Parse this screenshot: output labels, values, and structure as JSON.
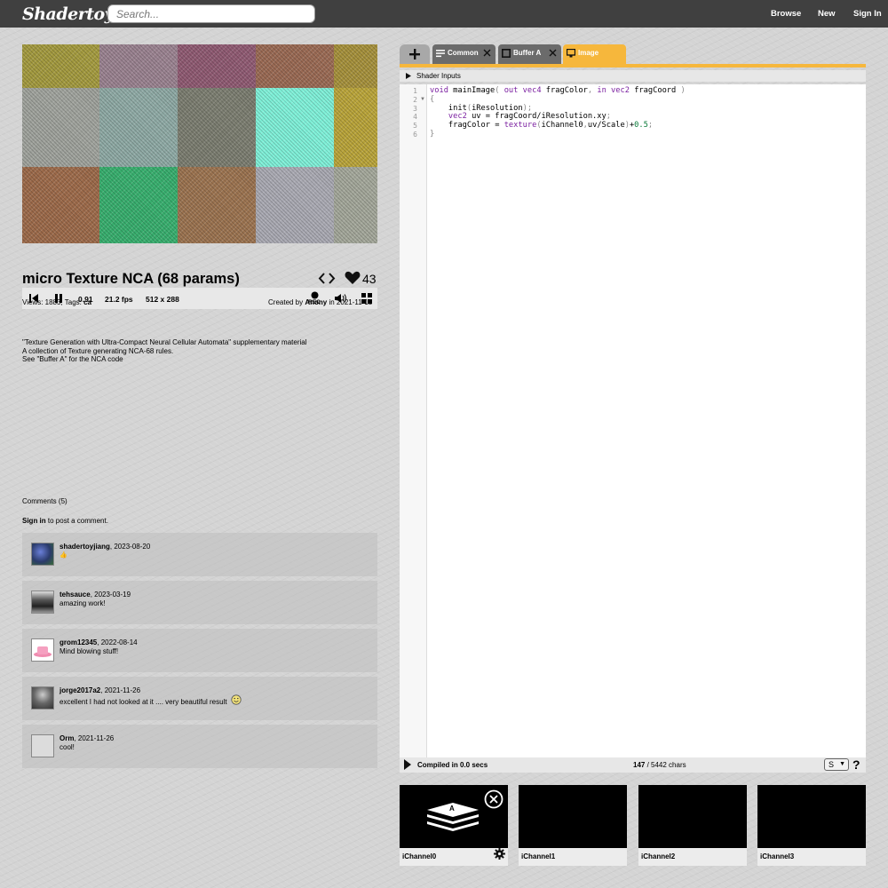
{
  "header": {
    "logo": "Shadertoy",
    "search_placeholder": "Search...",
    "nav": [
      "Browse",
      "New",
      "Sign In"
    ]
  },
  "player": {
    "time": "0.91",
    "fps": "21.2 fps",
    "resolution": "512 x 288",
    "rec_label": "REC",
    "tiles": [
      [
        "#a39a3f",
        "#9a8290",
        "#8f5a72",
        "#9a6a54",
        "#a6913c"
      ],
      [
        "#9fa29c",
        "#8ea9a4",
        "#7b7d70",
        "#7ff0d8",
        "#b9a43a"
      ],
      [
        "#9c6a4a",
        "#38ae6e",
        "#9b7350",
        "#a9a9b2",
        "#a3a79a"
      ]
    ]
  },
  "shader": {
    "title": "micro Texture NCA (68 params)",
    "likes": "43",
    "views_text": "Views: 1883, Tags: ",
    "tag": "ca",
    "created_by_prefix": "Created by ",
    "author": "Anony",
    "created_in": " in 2021-11-18",
    "description": [
      "\"Texture Generation with Ultra-Compact Neural Cellular Automata\" supplementary material",
      "A collection of Texture generating NCA-68 rules.",
      "See \"Buffer A\" for the NCA code"
    ]
  },
  "comments": {
    "header": "Comments (5)",
    "signin": "Sign in",
    "signin_suffix": " to post a comment.",
    "items": [
      {
        "user": "shadertoyjiang",
        "date": ", 2023-08-20",
        "text": "👍"
      },
      {
        "user": "tehsauce",
        "date": ", 2023-03-19",
        "text": "amazing work!"
      },
      {
        "user": "grom12345",
        "date": ", 2022-08-14",
        "text": "Mind blowing stuff!"
      },
      {
        "user": "jorge2017a2",
        "date": ", 2021-11-26",
        "text": "excellent I had not looked at it .... very beautiful result"
      },
      {
        "user": "Orm",
        "date": ", 2021-11-26",
        "text": "cool!"
      }
    ]
  },
  "editor": {
    "tabs": [
      "Common",
      "Buffer A",
      "Image"
    ],
    "shader_inputs": "Shader Inputs",
    "line_numbers": [
      "1",
      "2",
      "3",
      "4",
      "5",
      "6"
    ],
    "compiled": "Compiled in 0.0 secs",
    "chars_count": "147",
    "chars_total": " / 5442 chars",
    "font_select": "S",
    "help": "?"
  },
  "channels": {
    "labels": [
      "iChannel0",
      "iChannel1",
      "iChannel2",
      "iChannel3"
    ],
    "buffer_letter": "A"
  },
  "colors": {
    "header_bg": "#404040",
    "accent": "#f6b73c",
    "tab_inactive": "#6b6b6b"
  }
}
